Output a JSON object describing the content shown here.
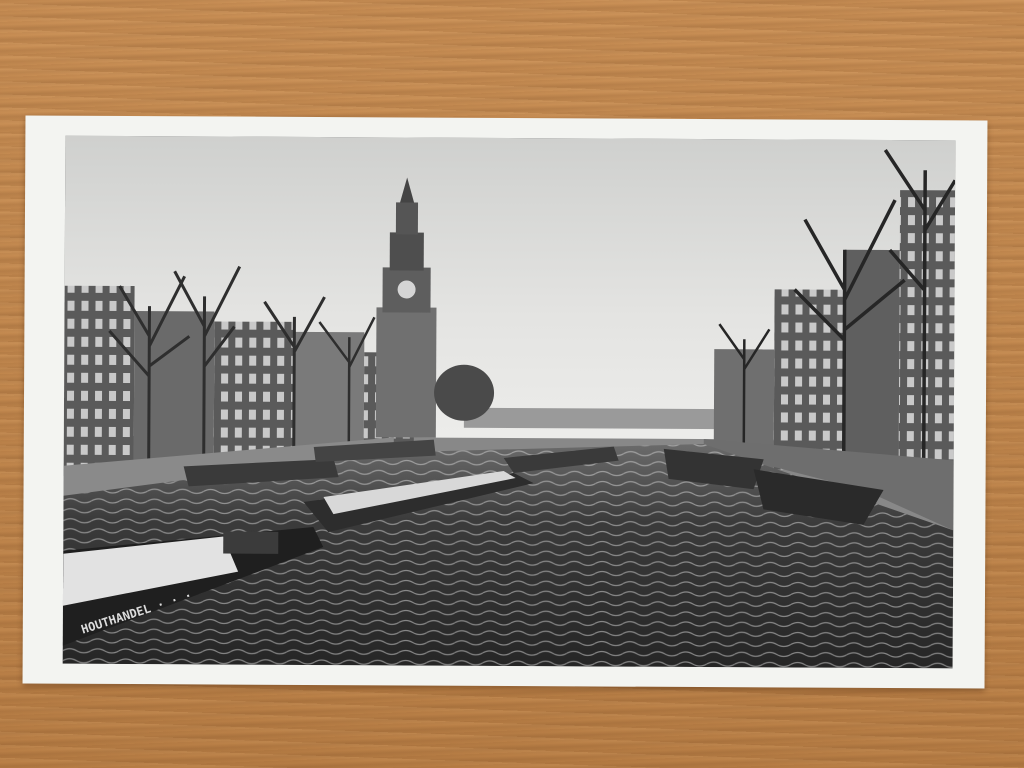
{
  "scene": {
    "subject": "Black-and-white photographic postcard of a canal with moored barges and a clock tower, lying on a wooden desk",
    "photo_style": "grayscale"
  },
  "boat_text": {
    "hull_lettering": "HOUTHANDEL  ·  ·  ·"
  },
  "colors": {
    "desk": "#c48a50",
    "card_border": "#f3f4f1",
    "sky": "#dcdcda",
    "water": "#3a3a3a"
  }
}
